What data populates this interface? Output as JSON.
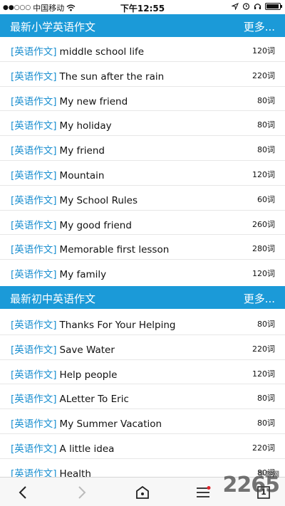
{
  "status_bar": {
    "carrier": "中国移动",
    "signal_dots": "●●○○○",
    "time": "下午12:55",
    "icons": [
      "location-icon",
      "alarm-icon",
      "headphones-icon",
      "battery-icon"
    ]
  },
  "sections": [
    {
      "title": "最新小学英语作文",
      "more": "更多...",
      "items": [
        {
          "tag": "[英语作文]",
          "title": "middle school life",
          "count": "120词"
        },
        {
          "tag": "[英语作文]",
          "title": "The sun after the rain",
          "count": "220词"
        },
        {
          "tag": "[英语作文]",
          "title": "My new friend",
          "count": "80词"
        },
        {
          "tag": "[英语作文]",
          "title": "My holiday",
          "count": "80词"
        },
        {
          "tag": "[英语作文]",
          "title": "My friend",
          "count": "80词"
        },
        {
          "tag": "[英语作文]",
          "title": "Mountain",
          "count": "120词"
        },
        {
          "tag": "[英语作文]",
          "title": "My School Rules",
          "count": "60词"
        },
        {
          "tag": "[英语作文]",
          "title": "My good friend",
          "count": "260词"
        },
        {
          "tag": "[英语作文]",
          "title": "Memorable first lesson",
          "count": "280词"
        },
        {
          "tag": "[英语作文]",
          "title": "My family",
          "count": "120词"
        }
      ]
    },
    {
      "title": "最新初中英语作文",
      "more": "更多...",
      "items": [
        {
          "tag": "[英语作文]",
          "title": "Thanks For Your Helping",
          "count": "80词"
        },
        {
          "tag": "[英语作文]",
          "title": "Save Water",
          "count": "220词"
        },
        {
          "tag": "[英语作文]",
          "title": "Help people",
          "count": "120词"
        },
        {
          "tag": "[英语作文]",
          "title": "ALetter To Eric",
          "count": "80词"
        },
        {
          "tag": "[英语作文]",
          "title": "My Summer Vacation",
          "count": "80词"
        },
        {
          "tag": "[英语作文]",
          "title": "A little idea",
          "count": "220词"
        },
        {
          "tag": "[英语作文]",
          "title": "Health",
          "count": "80词"
        }
      ]
    }
  ],
  "toolbar": {
    "tab_count": "1",
    "icons": [
      "back-icon",
      "forward-icon",
      "home-icon",
      "menu-icon",
      "tabs-icon"
    ]
  },
  "watermark": {
    "brand": "2265",
    "sub": "手游网"
  },
  "colors": {
    "header_bg": "#1b9ad8",
    "tag": "#1b8fd0",
    "divider": "#e7e7e7"
  }
}
